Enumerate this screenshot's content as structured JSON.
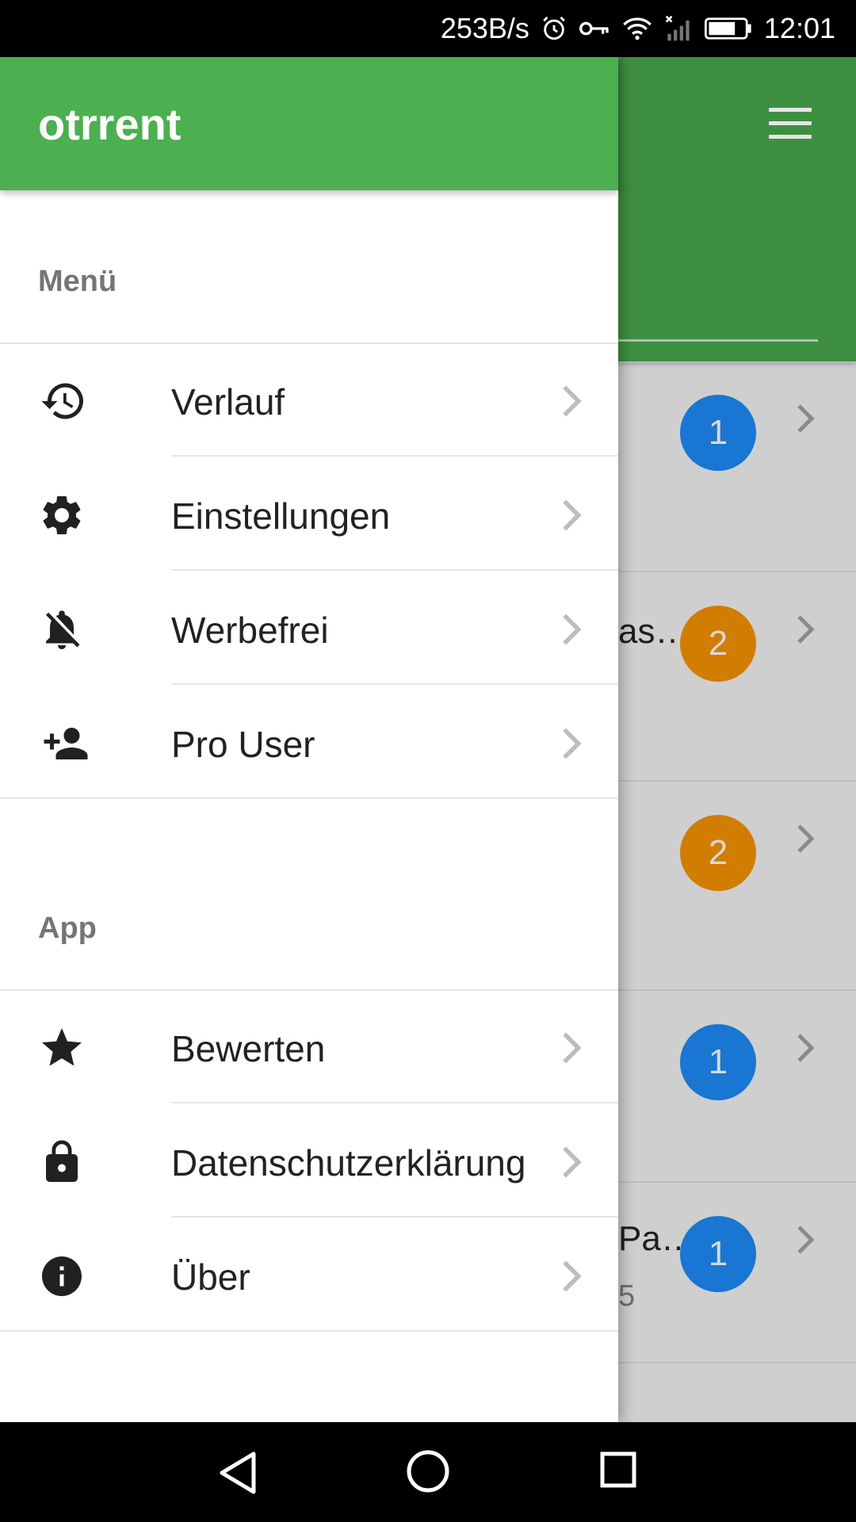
{
  "status_bar": {
    "net_speed": "253B/s",
    "time": "12:01",
    "icons": [
      "alarm-icon",
      "vpn-key-icon",
      "wifi-icon",
      "signal-icon",
      "battery-icon"
    ]
  },
  "drawer": {
    "app_title": "otrrent",
    "sections": [
      {
        "label": "Menü",
        "items": [
          {
            "label": "Verlauf",
            "icon": "history-icon"
          },
          {
            "label": "Einstellungen",
            "icon": "gear-icon"
          },
          {
            "label": "Werbefrei",
            "icon": "notifications-off-icon"
          },
          {
            "label": "Pro User",
            "icon": "person-add-icon"
          }
        ]
      },
      {
        "label": "App",
        "items": [
          {
            "label": "Bewerten",
            "icon": "star-icon"
          },
          {
            "label": "Datenschutzerklärung",
            "icon": "lock-icon"
          },
          {
            "label": "Über",
            "icon": "info-icon"
          }
        ]
      }
    ]
  },
  "background": {
    "rows": [
      {
        "badge": "1",
        "badge_color": "#1976d2",
        "text": "",
        "subtext": ""
      },
      {
        "badge": "2",
        "badge_color": "#d17d00",
        "text": "as…",
        "subtext": ""
      },
      {
        "badge": "2",
        "badge_color": "#d17d00",
        "text": "",
        "subtext": ""
      },
      {
        "badge": "1",
        "badge_color": "#1976d2",
        "text": "",
        "subtext": ""
      },
      {
        "badge": "1",
        "badge_color": "#1976d2",
        "text": "Pa…",
        "subtext": "5"
      }
    ]
  },
  "colors": {
    "accent": "#4caf50",
    "accent_dim": "#3f8f42",
    "badge_blue": "#1976d2",
    "badge_orange": "#d17d00"
  }
}
